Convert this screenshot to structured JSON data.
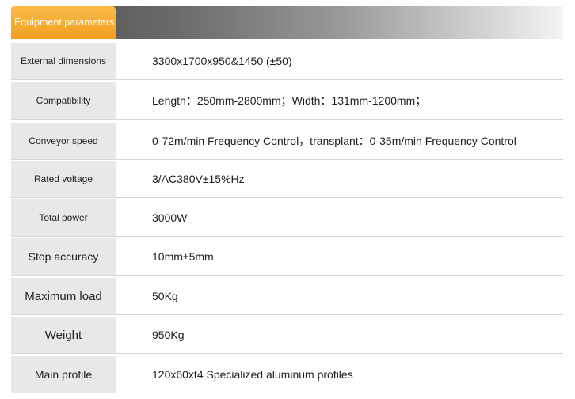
{
  "header": {
    "tab_label": "Equipment parameters"
  },
  "rows": [
    {
      "label": "External dimensions",
      "value": "3300x1700x950&1450 (±50)"
    },
    {
      "label": "Compatibility",
      "value": "Length：250mm-2800mm；Width：131mm-1200mm；"
    },
    {
      "label": "Conveyor speed",
      "value": "0-72m/min Frequency Control，transplant：0-35m/min Frequency Control"
    },
    {
      "label": "Rated voltage",
      "value": "3/AC380V±15%Hz"
    },
    {
      "label": "Total power",
      "value": "3000W"
    },
    {
      "label": "Stop accuracy",
      "value": "10mm±5mm"
    },
    {
      "label": "Maximum load",
      "value": "50Kg"
    },
    {
      "label": "Weight",
      "value": "950Kg"
    },
    {
      "label": "Main profile",
      "value": "120x60xt4 Specialized aluminum profiles"
    }
  ],
  "colors": {
    "accent": "#f2a020",
    "header_dark": "#4f4f4f",
    "label_bg": "#e8e8e8"
  }
}
